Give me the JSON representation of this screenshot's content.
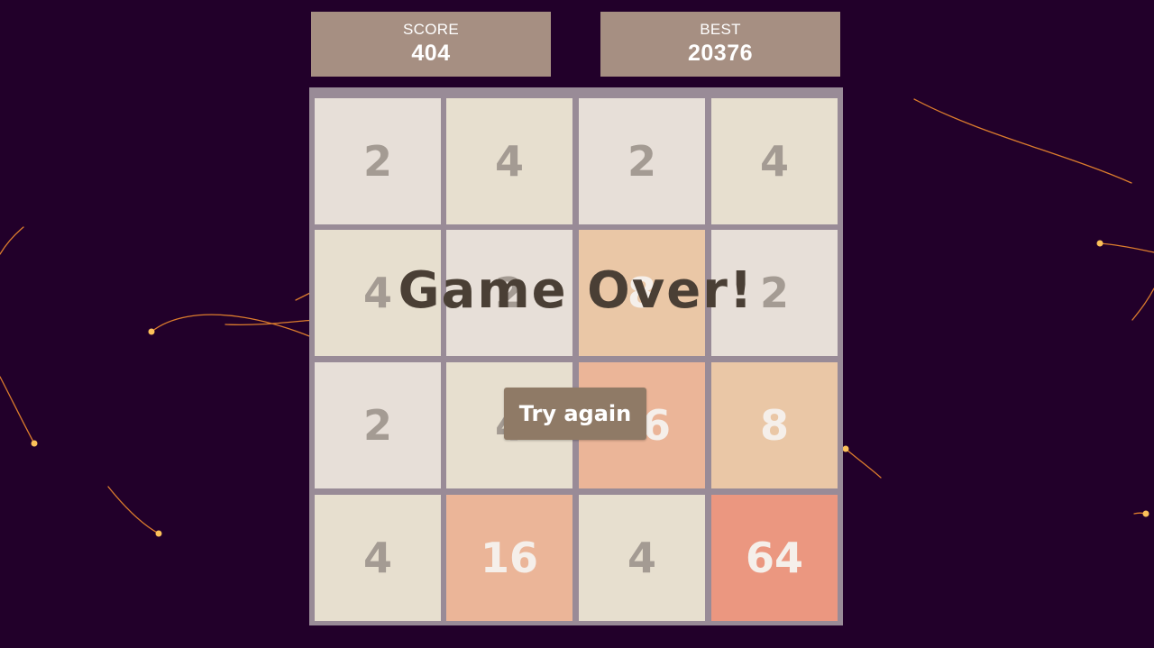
{
  "score": {
    "label": "SCORE",
    "value": "404"
  },
  "best": {
    "label": "BEST",
    "value": "20376"
  },
  "board": {
    "tiles": [
      [
        2,
        4,
        2,
        4
      ],
      [
        4,
        2,
        8,
        2
      ],
      [
        2,
        4,
        16,
        8
      ],
      [
        4,
        16,
        4,
        64
      ]
    ]
  },
  "overlay": {
    "message": "Game Over!",
    "button_label": "Try again"
  },
  "colors": {
    "background": "#22002a",
    "board": "#8e7f8e",
    "score_box": "#a68f82",
    "tile_2": "#e6dfd8",
    "tile_4": "#e6dfcd",
    "tile_8": "#eac39f",
    "tile_16": "#ebaf8f",
    "tile_64": "#eb8c74",
    "tile_text_dark": "#9a9189",
    "tile_text_light": "#f6f1ec",
    "streak": "#f08a2e",
    "streak_head": "#fcc15a"
  }
}
